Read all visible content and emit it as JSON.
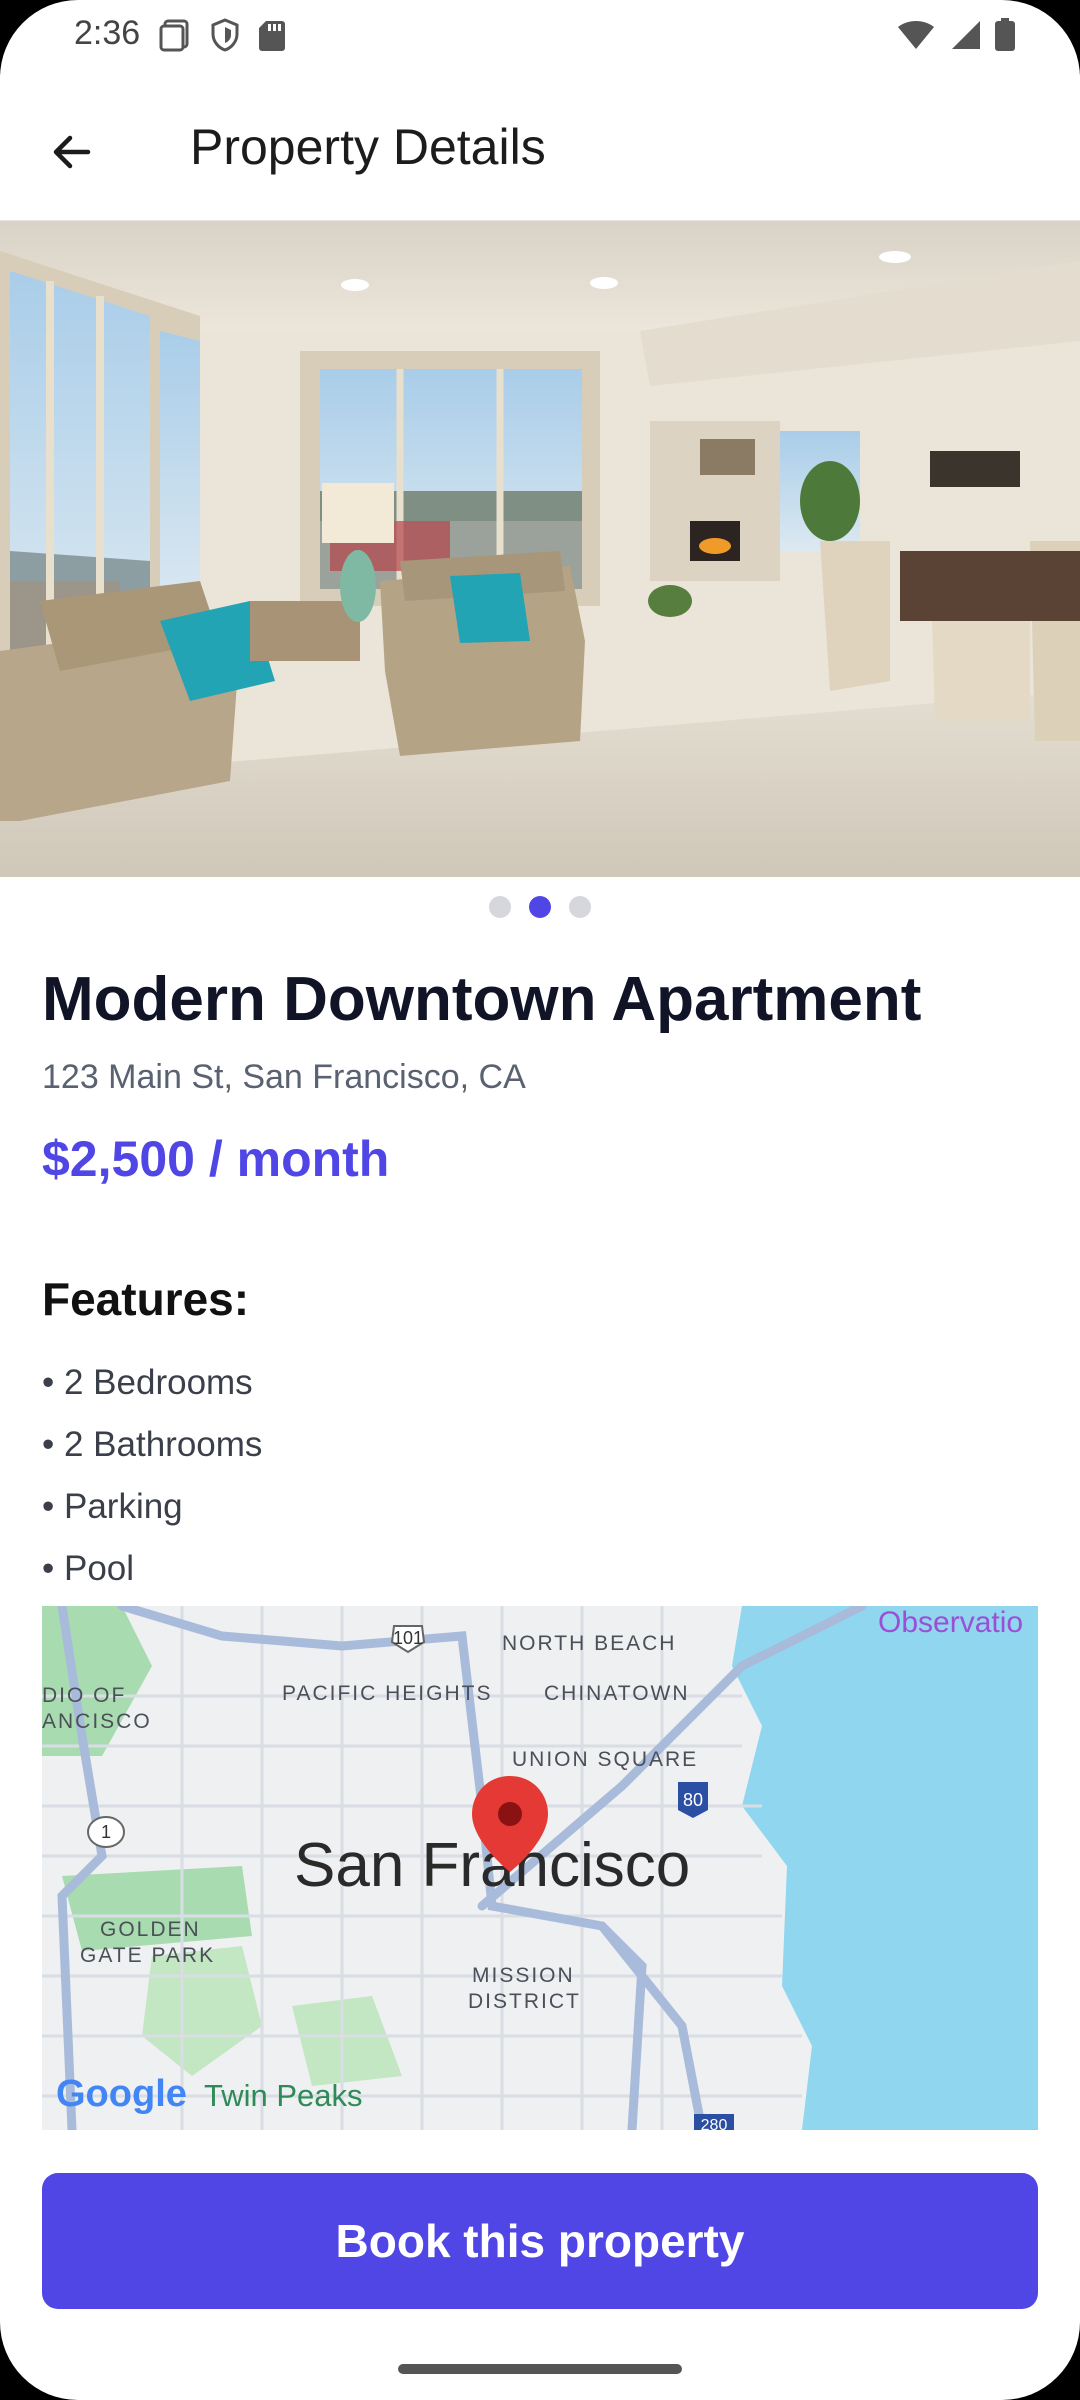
{
  "status_bar": {
    "time": "2:36",
    "icons_left": [
      "screenshot-icon",
      "shield-icon",
      "sd-card-icon"
    ],
    "icons_right": [
      "wifi-icon",
      "signal-icon",
      "battery-icon"
    ]
  },
  "app_bar": {
    "back_icon": "arrow-left-icon",
    "title": "Property Details"
  },
  "gallery": {
    "image": "living-room-photo",
    "page_count": 3,
    "active_index": 1
  },
  "property": {
    "title": "Modern Downtown Apartment",
    "address": "123 Main St, San Francisco, CA",
    "price": "$2,500 / month"
  },
  "features": {
    "heading": "Features:",
    "items": [
      "• 2 Bedrooms",
      "• 2 Bathrooms",
      "• Parking",
      "• Pool"
    ]
  },
  "map": {
    "city_label": "San Francisco",
    "labels": {
      "north_beach": "NORTH BEACH",
      "pacific_heights": "PACIFIC HEIGHTS",
      "chinatown": "CHINATOWN",
      "union_square": "UNION SQUARE",
      "golden_gate_1": "GOLDEN",
      "golden_gate_2": "GATE PARK",
      "mission_1": "MISSION",
      "mission_2": "DISTRICT",
      "twin_peaks": "Twin Peaks",
      "observatory": "Observatio",
      "presidio_1": "DIO OF",
      "presidio_2": "ANCISCO",
      "hwy_101": "101",
      "hwy_1": "1",
      "i80": "80",
      "i280": "280",
      "google": "Google"
    },
    "colors": {
      "water": "#8fd6ee",
      "park": "#a8dcb0",
      "road": "#c8d3e6"
    }
  },
  "cta": {
    "label": "Book this property"
  },
  "colors": {
    "accent": "#4f46e5",
    "title": "#101426",
    "muted": "#5a6170"
  }
}
